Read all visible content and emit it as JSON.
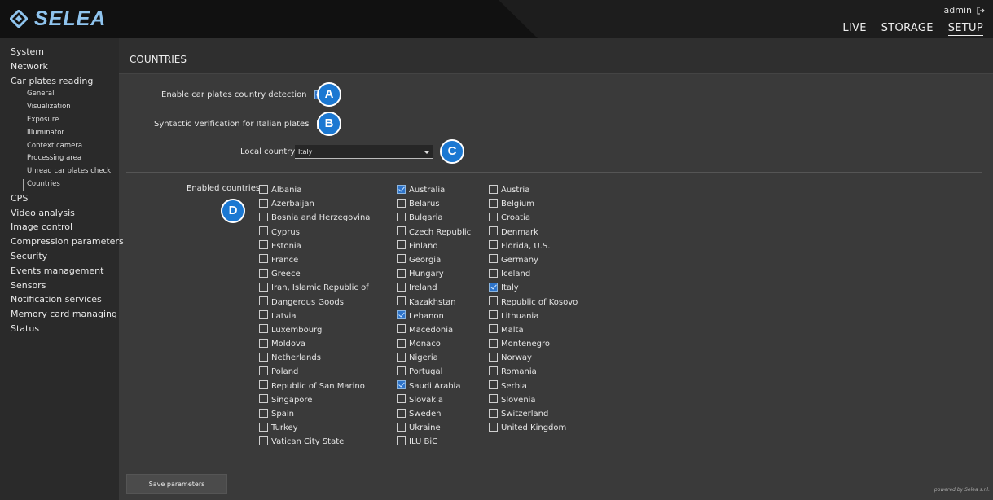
{
  "header": {
    "brand": "SELEA",
    "user": "admin",
    "logout_icon": "logout-icon",
    "nav": [
      {
        "label": "LIVE",
        "active": false
      },
      {
        "label": "STORAGE",
        "active": false
      },
      {
        "label": "SETUP",
        "active": true
      }
    ]
  },
  "sidebar": {
    "items": [
      {
        "label": "System",
        "type": "item"
      },
      {
        "label": "Network",
        "type": "item"
      },
      {
        "label": "Car plates reading",
        "type": "item"
      },
      {
        "label": "General",
        "type": "sub"
      },
      {
        "label": "Visualization",
        "type": "sub"
      },
      {
        "label": "Exposure",
        "type": "sub"
      },
      {
        "label": "Illuminator",
        "type": "sub"
      },
      {
        "label": "Context camera",
        "type": "sub"
      },
      {
        "label": "Processing area",
        "type": "sub"
      },
      {
        "label": "Unread car plates check",
        "type": "sub"
      },
      {
        "label": "Countries",
        "type": "sub",
        "current": true
      },
      {
        "label": "CPS",
        "type": "item"
      },
      {
        "label": "Video analysis",
        "type": "item"
      },
      {
        "label": "Image control",
        "type": "item"
      },
      {
        "label": "Compression parameters",
        "type": "item"
      },
      {
        "label": "Security",
        "type": "item"
      },
      {
        "label": "Events management",
        "type": "item"
      },
      {
        "label": "Sensors",
        "type": "item"
      },
      {
        "label": "Notification services",
        "type": "item"
      },
      {
        "label": "Memory card managing",
        "type": "item"
      },
      {
        "label": "Status",
        "type": "item"
      }
    ]
  },
  "page": {
    "title": "COUNTRIES",
    "enable_detection_label": "Enable car plates country detection",
    "enable_detection_checked": true,
    "syntactic_label": "Syntactic verification for Italian plates",
    "syntactic_checked": false,
    "local_country_label": "Local country",
    "local_country_value": "Italy",
    "enabled_countries_label": "Enabled countries",
    "save_button": "Save parameters",
    "powered_by": "powered by Selea s.r.l."
  },
  "badges": {
    "a": "A",
    "b": "B",
    "c": "C",
    "d": "D"
  },
  "colors": {
    "badge": "#1b78d2",
    "logo": "#8fc4ee",
    "checked": "#2d73c9"
  },
  "countries": {
    "col1": [
      {
        "name": "Albania",
        "checked": false
      },
      {
        "name": "Azerbaijan",
        "checked": false
      },
      {
        "name": "Bosnia and Herzegovina",
        "checked": false
      },
      {
        "name": "Cyprus",
        "checked": false
      },
      {
        "name": "Estonia",
        "checked": false
      },
      {
        "name": "France",
        "checked": false
      },
      {
        "name": "Greece",
        "checked": false
      },
      {
        "name": "Iran, Islamic Republic of",
        "checked": false
      },
      {
        "name": "Dangerous Goods",
        "checked": false
      },
      {
        "name": "Latvia",
        "checked": false
      },
      {
        "name": "Luxembourg",
        "checked": false
      },
      {
        "name": "Moldova",
        "checked": false
      },
      {
        "name": "Netherlands",
        "checked": false
      },
      {
        "name": "Poland",
        "checked": false
      },
      {
        "name": "Republic of San Marino",
        "checked": false
      },
      {
        "name": "Singapore",
        "checked": false
      },
      {
        "name": "Spain",
        "checked": false
      },
      {
        "name": "Turkey",
        "checked": false
      },
      {
        "name": "Vatican City State",
        "checked": false
      }
    ],
    "col2": [
      {
        "name": "Australia",
        "checked": true
      },
      {
        "name": "Belarus",
        "checked": false
      },
      {
        "name": "Bulgaria",
        "checked": false
      },
      {
        "name": "Czech Republic",
        "checked": false
      },
      {
        "name": "Finland",
        "checked": false
      },
      {
        "name": "Georgia",
        "checked": false
      },
      {
        "name": "Hungary",
        "checked": false
      },
      {
        "name": "Ireland",
        "checked": false
      },
      {
        "name": "Kazakhstan",
        "checked": false
      },
      {
        "name": "Lebanon",
        "checked": true
      },
      {
        "name": "Macedonia",
        "checked": false
      },
      {
        "name": "Monaco",
        "checked": false
      },
      {
        "name": "Nigeria",
        "checked": false
      },
      {
        "name": "Portugal",
        "checked": false
      },
      {
        "name": "Saudi Arabia",
        "checked": true
      },
      {
        "name": "Slovakia",
        "checked": false
      },
      {
        "name": "Sweden",
        "checked": false
      },
      {
        "name": "Ukraine",
        "checked": false
      },
      {
        "name": "ILU BiC",
        "checked": false
      }
    ],
    "col3": [
      {
        "name": "Austria",
        "checked": false
      },
      {
        "name": "Belgium",
        "checked": false
      },
      {
        "name": "Croatia",
        "checked": false
      },
      {
        "name": "Denmark",
        "checked": false
      },
      {
        "name": "Florida, U.S.",
        "checked": false
      },
      {
        "name": "Germany",
        "checked": false
      },
      {
        "name": "Iceland",
        "checked": false
      },
      {
        "name": "Italy",
        "checked": true
      },
      {
        "name": "Republic of Kosovo",
        "checked": false
      },
      {
        "name": "Lithuania",
        "checked": false
      },
      {
        "name": "Malta",
        "checked": false
      },
      {
        "name": "Montenegro",
        "checked": false
      },
      {
        "name": "Norway",
        "checked": false
      },
      {
        "name": "Romania",
        "checked": false
      },
      {
        "name": "Serbia",
        "checked": false
      },
      {
        "name": "Slovenia",
        "checked": false
      },
      {
        "name": "Switzerland",
        "checked": false
      },
      {
        "name": "United Kingdom",
        "checked": false
      }
    ]
  }
}
